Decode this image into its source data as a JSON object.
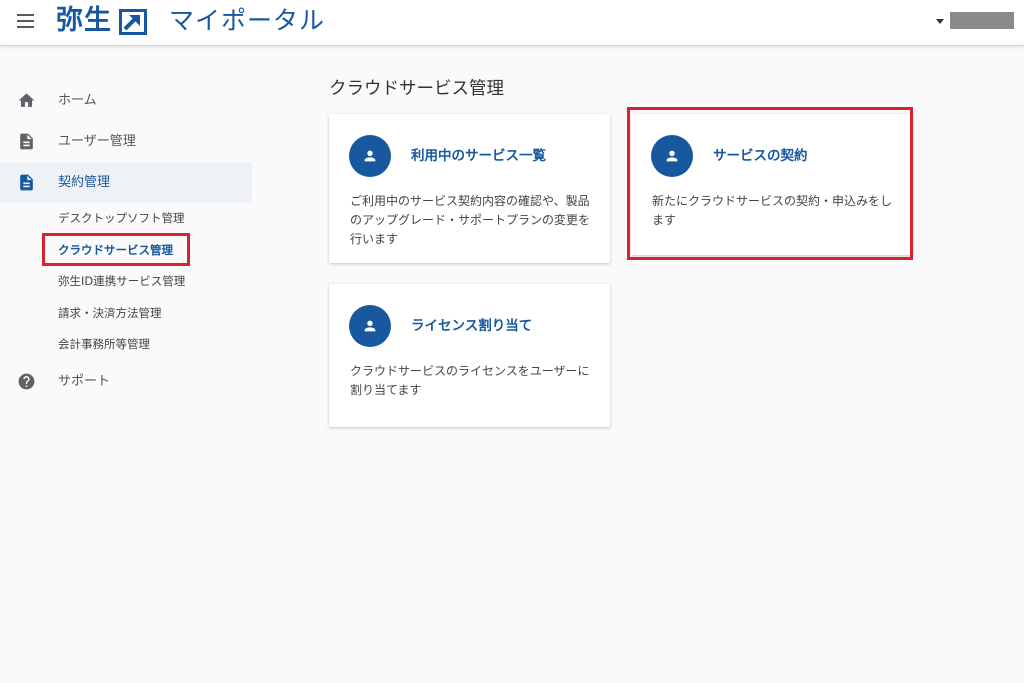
{
  "header": {
    "logo_text": "弥生",
    "title": "マイポータル"
  },
  "sidebar": {
    "items": [
      {
        "label": "ホーム",
        "icon": "home-icon"
      },
      {
        "label": "ユーザー管理",
        "icon": "document-icon"
      },
      {
        "label": "契約管理",
        "icon": "document-icon",
        "active": true
      },
      {
        "label": "サポート",
        "icon": "help-icon"
      }
    ],
    "contract_sub_items": [
      {
        "label": "デスクトップソフト管理"
      },
      {
        "label": "クラウドサービス管理",
        "current": true
      },
      {
        "label": "弥生ID連携サービス管理"
      },
      {
        "label": "請求・決済方法管理"
      },
      {
        "label": "会計事務所等管理"
      }
    ]
  },
  "main": {
    "title": "クラウドサービス管理",
    "cards": [
      {
        "title": "利用中のサービス一覧",
        "description": "ご利用中のサービス契約内容の確認や、製品のアップグレード・サポートプランの変更を行います"
      },
      {
        "title": "サービスの契約",
        "description": "新たにクラウドサービスの契約・申込みをします"
      },
      {
        "title": "ライセンス割り当て",
        "description": "クラウドサービスのライセンスをユーザーに割り当てます"
      }
    ]
  },
  "colors": {
    "brand": "#17589e",
    "highlight": "#d9232e",
    "background": "#fafafa"
  }
}
